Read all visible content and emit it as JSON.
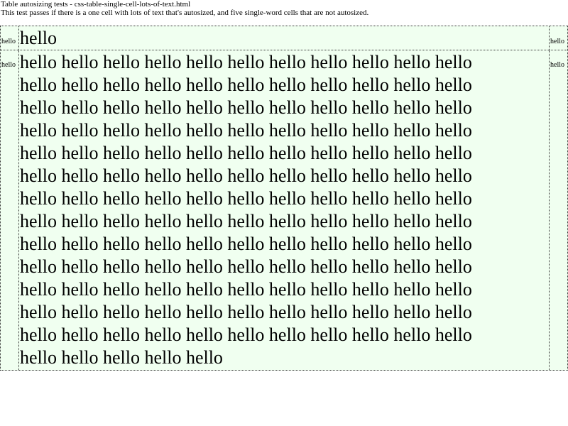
{
  "document": {
    "heading_title": "Table autosizing tests - css-table-single-cell-lots-of-text.html",
    "heading_description": "This test passes if there is a one cell with lots of text that's autosized, and five single-word cells that are not autosized."
  },
  "table": {
    "row_1": {
      "left_cell": "hello",
      "center_cell": "hello",
      "right_cell": "hello"
    },
    "row_2": {
      "left_cell": "hello",
      "center_cell": "hello hello hello hello hello hello hello hello hello hello hello hello hello hello hello hello hello hello hello hello hello hello hello hello hello hello hello hello hello hello hello hello hello hello hello hello hello hello hello hello hello hello hello hello hello hello hello hello hello hello hello hello hello hello hello hello hello hello hello hello hello hello hello hello hello hello hello hello hello hello hello hello hello hello hello hello hello hello hello hello hello hello hello hello hello hello hello hello hello hello hello hello hello hello hello hello hello hello hello hello hello hello hello hello hello hello hello hello hello hello hello hello hello hello hello hello hello hello hello hello hello hello hello hello hello hello hello hello hello hello hello hello hello hello hello hello hello hello hello hello hello hello hello hello hello hello hello hello",
      "right_cell": "hello"
    }
  },
  "colors": {
    "cell_background": "#f0fff0",
    "border": "#333333",
    "text": "#000000"
  }
}
